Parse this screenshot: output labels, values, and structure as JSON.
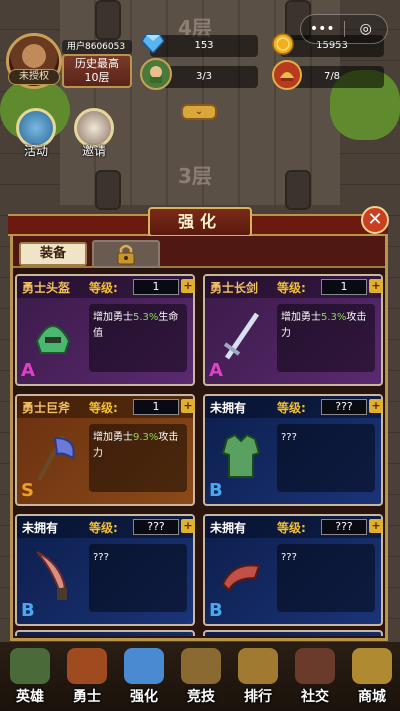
{
  "hud": {
    "username": "未授权",
    "user_id": "用户8606053",
    "history_best_label": "历史最高",
    "history_best_value": "10层",
    "diamonds": "153",
    "gold": "15953",
    "heroes": "3/3",
    "warriors": "7/8"
  },
  "tower": {
    "floor_upper": "4层",
    "floor_lower": "3层"
  },
  "side_buttons": [
    {
      "label": "活动"
    },
    {
      "label": "邀请"
    }
  ],
  "panel": {
    "title": "强化",
    "tabs": [
      {
        "label": "装备"
      }
    ]
  },
  "level_label": "等级:",
  "cards": [
    {
      "name": "勇士头盔",
      "level": "1",
      "grade": "A",
      "desc_pre": "增加勇士",
      "pct": "5.3%",
      "desc_post": "生命值",
      "state": "owned",
      "icon": "helmet-icon"
    },
    {
      "name": "勇士长剑",
      "level": "1",
      "grade": "A",
      "desc_pre": "增加勇士",
      "pct": "5.3%",
      "desc_post": "攻击力",
      "state": "owned",
      "icon": "sword-icon"
    },
    {
      "name": "勇士巨斧",
      "level": "1",
      "grade": "S",
      "desc_pre": "增加勇士",
      "pct": "9.3%",
      "desc_post": "攻击力",
      "state": "owned-s",
      "icon": "axe-icon"
    },
    {
      "name": "未拥有",
      "level": "???",
      "grade": "B",
      "desc_pre": "???",
      "pct": "",
      "desc_post": "",
      "state": "unowned",
      "icon": "armor-icon"
    },
    {
      "name": "未拥有",
      "level": "???",
      "grade": "B",
      "desc_pre": "???",
      "pct": "",
      "desc_post": "",
      "state": "unowned",
      "icon": "dagger-icon"
    },
    {
      "name": "未拥有",
      "level": "???",
      "grade": "B",
      "desc_pre": "???",
      "pct": "",
      "desc_post": "",
      "state": "unowned",
      "icon": "bracer-icon"
    }
  ],
  "bottom_nav": [
    {
      "label": "英雄"
    },
    {
      "label": "勇士"
    },
    {
      "label": "强化"
    },
    {
      "label": "竞技"
    },
    {
      "label": "排行"
    },
    {
      "label": "社交"
    },
    {
      "label": "商城"
    }
  ],
  "colors": {
    "accent_gold": "#d9b25e",
    "panel_red": "#6b1a10",
    "pct_green": "#7ee04a"
  }
}
